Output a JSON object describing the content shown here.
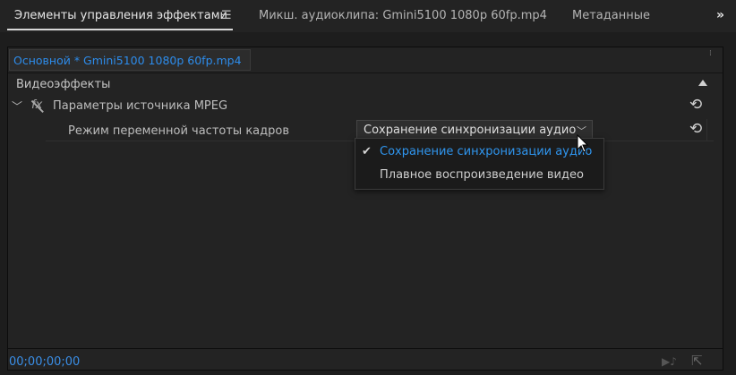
{
  "tabs": {
    "active": "Элементы управления эффектами",
    "menu_icon": "☰",
    "audio_mixer": "Микш. аудиоклипа: Gmini5100 1080p 60fp.mp4",
    "metadata": "Метаданные",
    "overflow_icon": "»"
  },
  "panel": {
    "clip_tab": "Основной * Gmini5100 1080p 60fp.mp4",
    "section_title": "Видеоэффекты",
    "effect_name": "Параметры источника MPEG",
    "param_label": "Режим переменной частоты кадров",
    "param_value": "Сохранение синхронизации аудио",
    "dropdown_options": [
      {
        "label": "Сохранение синхронизации аудио",
        "selected": true
      },
      {
        "label": "Плавное воспроизведение видео",
        "selected": false
      }
    ]
  },
  "footer": {
    "timecode": "00;00;00;00"
  },
  "colors": {
    "accent_blue": "#2d8ceb",
    "background": "#232323",
    "text": "#c4c4c4"
  },
  "icons": {
    "chevron": "chevron-down-icon",
    "fx": "fx-icon",
    "reset": "reset-icon",
    "check": "checkmark-icon"
  }
}
